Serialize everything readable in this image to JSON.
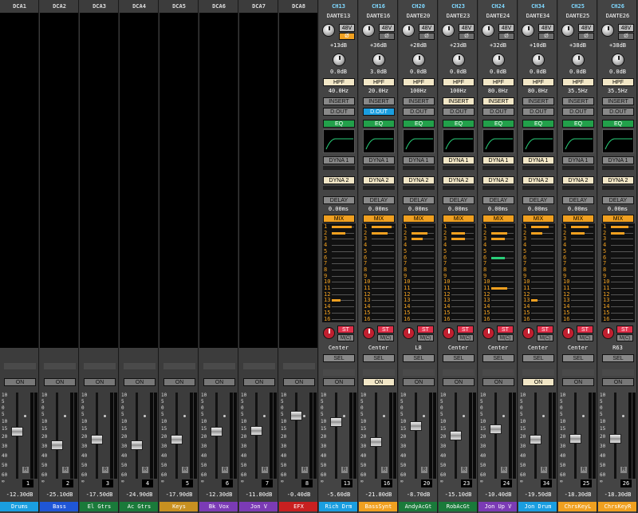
{
  "dca": [
    {
      "name": "DCA1",
      "on": "ON",
      "num": "1",
      "level": "-12.30dB",
      "label": "Drums",
      "labelColor": "#1a9ee0",
      "labelText": "#fff",
      "fader": 0.55
    },
    {
      "name": "DCA2",
      "on": "ON",
      "num": "2",
      "level": "-25.10dB",
      "label": "Bass",
      "labelColor": "#1f56d6",
      "labelText": "#fff",
      "fader": 0.38
    },
    {
      "name": "DCA3",
      "on": "ON",
      "num": "3",
      "level": "-17.50dB",
      "label": "El Gtrs",
      "labelColor": "#1a7a3a",
      "labelText": "#fff",
      "fader": 0.45
    },
    {
      "name": "DCA4",
      "on": "ON",
      "num": "4",
      "level": "-24.90dB",
      "label": "Ac Gtrs",
      "labelColor": "#1a7a3a",
      "labelText": "#fff",
      "fader": 0.38
    },
    {
      "name": "DCA5",
      "on": "ON",
      "num": "5",
      "level": "-17.90dB",
      "label": "Keys",
      "labelColor": "#c89020",
      "labelText": "#fff",
      "fader": 0.45
    },
    {
      "name": "DCA6",
      "on": "ON",
      "num": "6",
      "level": "-12.30dB",
      "label": "Bk Vox",
      "labelColor": "#7b3bb5",
      "labelText": "#fff",
      "fader": 0.55
    },
    {
      "name": "DCA7",
      "on": "ON",
      "num": "7",
      "level": "-11.80dB",
      "label": "Jon V",
      "labelColor": "#7b3bb5",
      "labelText": "#fff",
      "fader": 0.56
    },
    {
      "name": "DCA8",
      "on": "ON",
      "num": "8",
      "level": "-0.40dB",
      "label": "EFX",
      "labelColor": "#c82020",
      "labelText": "#fff",
      "fader": 0.76
    }
  ],
  "channels": [
    {
      "ch": "CH13",
      "src": "DANTE13",
      "phantom": "48V",
      "phi": "Ø",
      "phiOn": true,
      "gain": "+13dB",
      "trim": "0.0dB",
      "hpf": "HPF",
      "hpfFreq": "40.0Hz",
      "insert": "INSERT",
      "insertLit": false,
      "dout": "D.OUT",
      "doutLit": false,
      "eq": "EQ",
      "dyna1": "DYNA 1",
      "dyna1Lit": false,
      "dyna2": "DYNA 2",
      "dyna2Lit": true,
      "delay": "DELAY",
      "delayVal": "0.00ms",
      "mix": "MIX",
      "sends": [
        {
          "row": 0,
          "w": 0.9
        },
        {
          "row": 1,
          "w": 0.6
        },
        {
          "row": 12,
          "w": 0.4
        }
      ],
      "st": "ST",
      "mc": "M(C)",
      "pan": "Center",
      "sel": "SEL",
      "on": "ON",
      "onLit": false,
      "num": "13",
      "level": "-5.60dB",
      "label": "Rich Drm",
      "labelColor": "#1a9ee0",
      "labelText": "#fff",
      "fader": 0.68
    },
    {
      "ch": "CH16",
      "src": "DANTE16",
      "phantom": "48V",
      "phi": "Ø",
      "phiOn": false,
      "gain": "+36dB",
      "trim": "3.0dB",
      "hpf": "HPF",
      "hpfFreq": "20.0Hz",
      "insert": "INSERT",
      "insertLit": false,
      "dout": "D.OUT",
      "doutLit": true,
      "eq": "EQ",
      "dyna1": "DYNA 1",
      "dyna1Lit": false,
      "dyna2": "DYNA 2",
      "dyna2Lit": true,
      "delay": "DELAY",
      "delayVal": "0.00ms",
      "mix": "MIX",
      "sends": [
        {
          "row": 0,
          "w": 0.9
        },
        {
          "row": 1,
          "w": 0.7
        }
      ],
      "st": "ST",
      "mc": "M(C)",
      "pan": "Center",
      "sel": "SEL",
      "on": "ON",
      "onLit": true,
      "num": "16",
      "level": "-21.80dB",
      "label": "BassSynt",
      "labelColor": "#f0a020",
      "labelText": "#fff",
      "fader": 0.42
    },
    {
      "ch": "CH20",
      "src": "DANTE20",
      "phantom": "48V",
      "phi": "Ø",
      "phiOn": false,
      "gain": "+28dB",
      "trim": "0.0dB",
      "hpf": "HPF",
      "hpfFreq": "100Hz",
      "insert": "INSERT",
      "insertLit": false,
      "dout": "D.OUT",
      "doutLit": false,
      "eq": "EQ",
      "dyna1": "DYNA 1",
      "dyna1Lit": false,
      "dyna2": "DYNA 2",
      "dyna2Lit": true,
      "delay": "DELAY",
      "delayVal": "0.00ms",
      "mix": "MIX",
      "sends": [
        {
          "row": 1,
          "w": 0.7
        },
        {
          "row": 2,
          "w": 0.5
        }
      ],
      "st": "ST",
      "mc": "M(C)",
      "pan": "L8",
      "sel": "SEL",
      "on": "ON",
      "onLit": false,
      "num": "20",
      "level": "-8.70dB",
      "label": "AndyAcGt",
      "labelColor": "#1a7a3a",
      "labelText": "#fff",
      "fader": 0.62
    },
    {
      "ch": "CH23",
      "src": "DANTE23",
      "phantom": "48V",
      "phi": "Ø",
      "phiOn": false,
      "gain": "+23dB",
      "trim": "0.0dB",
      "hpf": "HPF",
      "hpfFreq": "100Hz",
      "insert": "INSERT",
      "insertLit": true,
      "dout": "D.OUT",
      "doutLit": false,
      "eq": "EQ",
      "dyna1": "DYNA 1",
      "dyna1Lit": true,
      "dyna2": "DYNA 2",
      "dyna2Lit": true,
      "delay": "DELAY",
      "delayVal": "0.00ms",
      "mix": "MIX",
      "sends": [
        {
          "row": 1,
          "w": 0.6
        },
        {
          "row": 2,
          "w": 0.6
        }
      ],
      "st": "ST",
      "mc": "M(C)",
      "pan": "Center",
      "sel": "SEL",
      "on": "ON",
      "onLit": false,
      "num": "23",
      "level": "-15.10dB",
      "label": "RobAcGt",
      "labelColor": "#1a7a3a",
      "labelText": "#fff",
      "fader": 0.5
    },
    {
      "ch": "CH24",
      "src": "DANTE24",
      "phantom": "48V",
      "phi": "Ø",
      "phiOn": false,
      "gain": "+32dB",
      "trim": "0.0dB",
      "hpf": "HPF",
      "hpfFreq": "80.0Hz",
      "insert": "INSERT",
      "insertLit": true,
      "dout": "D.OUT",
      "doutLit": false,
      "eq": "EQ",
      "dyna1": "DYNA 1",
      "dyna1Lit": true,
      "dyna2": "DYNA 2",
      "dyna2Lit": true,
      "delay": "DELAY",
      "delayVal": "0.00ms",
      "mix": "MIX",
      "sends": [
        {
          "row": 1,
          "w": 0.7
        },
        {
          "row": 2,
          "w": 0.6
        },
        {
          "row": 5,
          "w": 0.6,
          "green": true
        },
        {
          "row": 10,
          "w": 0.7
        }
      ],
      "st": "ST",
      "mc": "M(C)",
      "pan": "Center",
      "sel": "SEL",
      "on": "ON",
      "onLit": false,
      "num": "24",
      "level": "-10.40dB",
      "label": "Jon Up V",
      "labelColor": "#7b3bb5",
      "labelText": "#fff",
      "fader": 0.58
    },
    {
      "ch": "CH34",
      "src": "DANTE34",
      "phantom": "48V",
      "phi": "Ø",
      "phiOn": false,
      "gain": "+10dB",
      "trim": "0.0dB",
      "hpf": "HPF",
      "hpfFreq": "80.0Hz",
      "insert": "INSERT",
      "insertLit": false,
      "dout": "D.OUT",
      "doutLit": false,
      "eq": "EQ",
      "dyna1": "DYNA 1",
      "dyna1Lit": true,
      "dyna2": "DYNA 2",
      "dyna2Lit": true,
      "delay": "DELAY",
      "delayVal": "0.00ms",
      "mix": "MIX",
      "sends": [
        {
          "row": 0,
          "w": 0.8
        },
        {
          "row": 1,
          "w": 0.5
        },
        {
          "row": 12,
          "w": 0.3
        }
      ],
      "st": "ST",
      "mc": "M(C)",
      "pan": "Center",
      "sel": "SEL",
      "on": "ON",
      "onLit": true,
      "num": "34",
      "level": "-19.50dB",
      "label": "Jon Drum",
      "labelColor": "#1a9ee0",
      "labelText": "#fff",
      "fader": 0.45
    },
    {
      "ch": "CH25",
      "src": "DANTE25",
      "phantom": "48V",
      "phi": "Ø",
      "phiOn": false,
      "gain": "+38dB",
      "trim": "0.0dB",
      "hpf": "HPF",
      "hpfFreq": "35.5Hz",
      "insert": "INSERT",
      "insertLit": false,
      "dout": "D.OUT",
      "doutLit": false,
      "eq": "EQ",
      "dyna1": "DYNA 1",
      "dyna1Lit": false,
      "dyna2": "DYNA 2",
      "dyna2Lit": true,
      "delay": "DELAY",
      "delayVal": "0.00ms",
      "mix": "MIX",
      "sends": [
        {
          "row": 0,
          "w": 0.8
        },
        {
          "row": 1,
          "w": 0.6
        }
      ],
      "st": "ST",
      "mc": "M(C)",
      "pan": "Center",
      "sel": "SEL",
      "on": "ON",
      "onLit": false,
      "num": "25",
      "level": "-18.30dB",
      "label": "ChrsKeyL",
      "labelColor": "#f0a020",
      "labelText": "#fff",
      "fader": 0.46
    },
    {
      "ch": "CH26",
      "src": "DANTE26",
      "phantom": "48V",
      "phi": "Ø",
      "phiOn": false,
      "gain": "+38dB",
      "trim": "0.0dB",
      "hpf": "HPF",
      "hpfFreq": "35.5Hz",
      "insert": "INSERT",
      "insertLit": false,
      "dout": "D.OUT",
      "doutLit": false,
      "eq": "EQ",
      "dyna1": "DYNA 1",
      "dyna1Lit": false,
      "dyna2": "DYNA 2",
      "dyna2Lit": true,
      "delay": "DELAY",
      "delayVal": "0.00ms",
      "mix": "MIX",
      "sends": [
        {
          "row": 0,
          "w": 0.8
        },
        {
          "row": 1,
          "w": 0.6
        }
      ],
      "st": "ST",
      "mc": "M(C)",
      "pan": "R63",
      "sel": "SEL",
      "on": "ON",
      "onLit": false,
      "num": "26",
      "level": "-18.30dB",
      "label": "ChrsKeyR",
      "labelColor": "#f0a020",
      "labelText": "#fff",
      "fader": 0.46
    }
  ],
  "mixRows": [
    "1",
    "2",
    "3",
    "4",
    "5",
    "6",
    "7",
    "8",
    "9",
    "10",
    "11",
    "12",
    "13",
    "14",
    "15",
    "16"
  ],
  "faderScale": [
    "10",
    "5",
    "0",
    "5",
    "10",
    "15",
    "20",
    "30",
    "40",
    "50",
    "60",
    "∞"
  ],
  "recall": "R"
}
